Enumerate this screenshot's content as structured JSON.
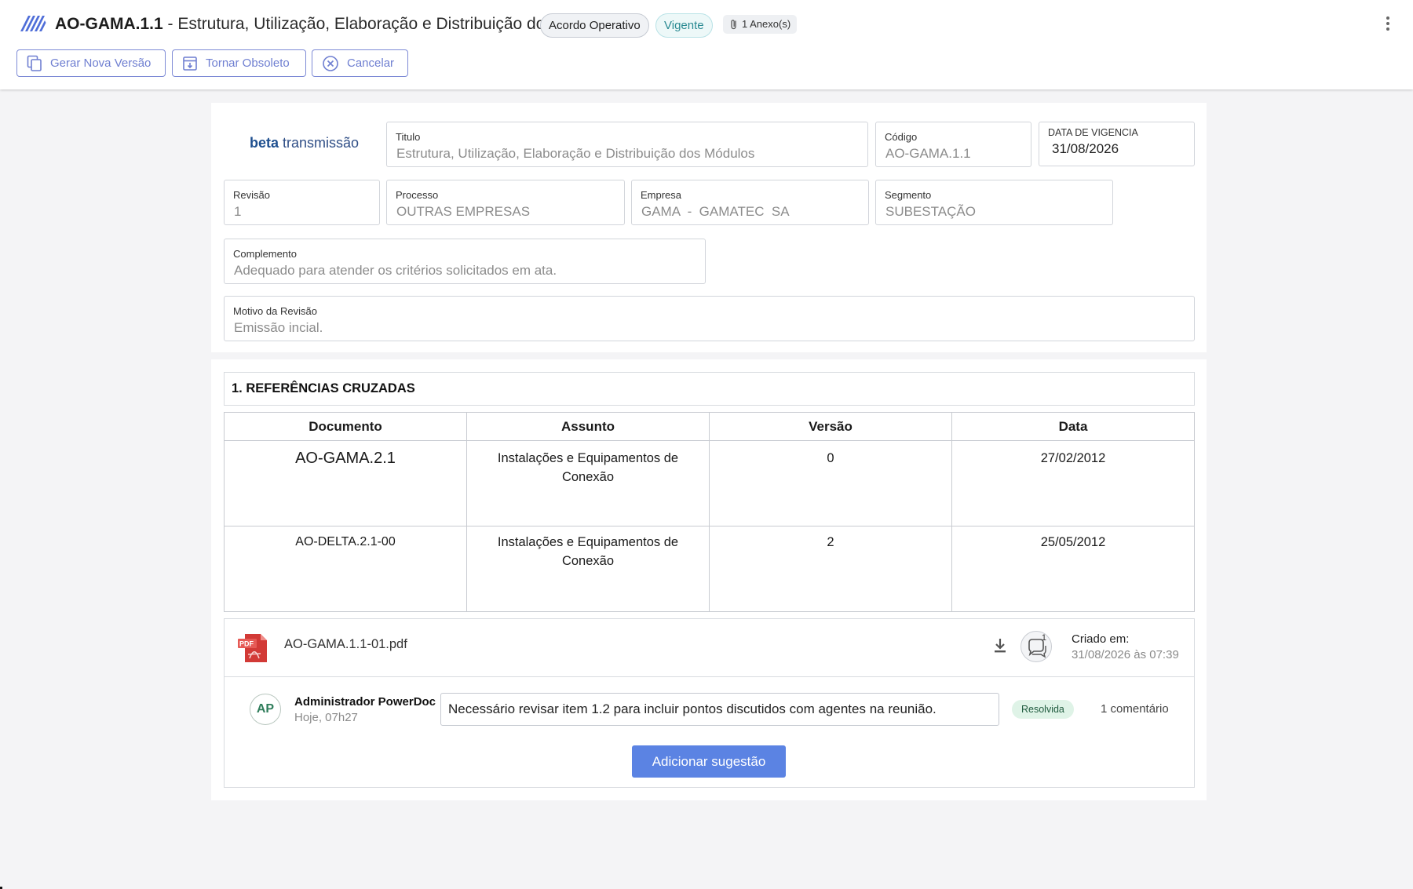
{
  "header": {
    "doc_code": "AO-GAMA.1.1",
    "doc_title": " - Estrutura, Utilização, Elaboração e Distribuição dos ...",
    "type_chip": "Acordo Operativo",
    "status_chip": "Vigente",
    "attachments": "1 Anexo(s)",
    "more_icon": "more-vertical-icon"
  },
  "actions": {
    "new_version": "Gerar Nova Versão",
    "make_obsolete": "Tornar Obsoleto",
    "cancel": "Cancelar"
  },
  "brand": {
    "strong": "beta",
    "rest": " transmissão"
  },
  "form": {
    "titulo": {
      "label": "Titulo",
      "value": "Estrutura, Utilização, Elaboração e Distribuição dos Módulos"
    },
    "codigo": {
      "label": "Código",
      "value": "AO-GAMA.1.1"
    },
    "vigencia": {
      "label": "DATA DE VIGENCIA",
      "value": "31/08/2026"
    },
    "revisao": {
      "label": "Revisão",
      "value": "1"
    },
    "processo": {
      "label": "Processo",
      "value": "OUTRAS EMPRESAS"
    },
    "empresa": {
      "label": "Empresa",
      "value": "GAMA  -  GAMATEC  SA"
    },
    "segmento": {
      "label": "Segmento",
      "value": "SUBESTAÇÃO"
    },
    "complemento": {
      "label": "Complemento",
      "value": "Adequado para atender os critérios solicitados em ata."
    },
    "motivo": {
      "label": "Motivo da Revisão",
      "value": "Emissão incial."
    }
  },
  "section": {
    "title": "1. REFERÊNCIAS CRUZADAS",
    "columns": [
      "Documento",
      "Assunto",
      "Versão",
      "Data"
    ],
    "rows": [
      {
        "documento": "AO-GAMA.2.1",
        "assunto": "Instalações e Equipamentos de Conexão",
        "versao": "0",
        "data": "27/02/2012"
      },
      {
        "documento": "AO-DELTA.2.1-00",
        "assunto": "Instalações e Equipamentos de Conexão",
        "versao": "2",
        "data": "25/05/2012"
      }
    ]
  },
  "attachment": {
    "file_name": "AO-GAMA.1.1-01.pdf",
    "comment_badge": "1",
    "created_label": "Criado em:",
    "created_date": "31/08/2026 às 07:39"
  },
  "suggestion": {
    "avatar": "AP",
    "author": "Administrador PowerDoc",
    "time": "Hoje, 07h27",
    "text": "Necessário revisar item 1.2 para incluir pontos discutidos com agentes na reunião.",
    "status": "Resolvida",
    "comments": "1 comentário"
  },
  "add_suggestion": "Adicionar sugestão",
  "colors": {
    "accent": "#5b83e3",
    "outline_button": "#7e8bd6",
    "status_vigente": "#2a8a92",
    "resolved_bg": "#dff3e7",
    "avatar_text": "#2f7d5b"
  }
}
